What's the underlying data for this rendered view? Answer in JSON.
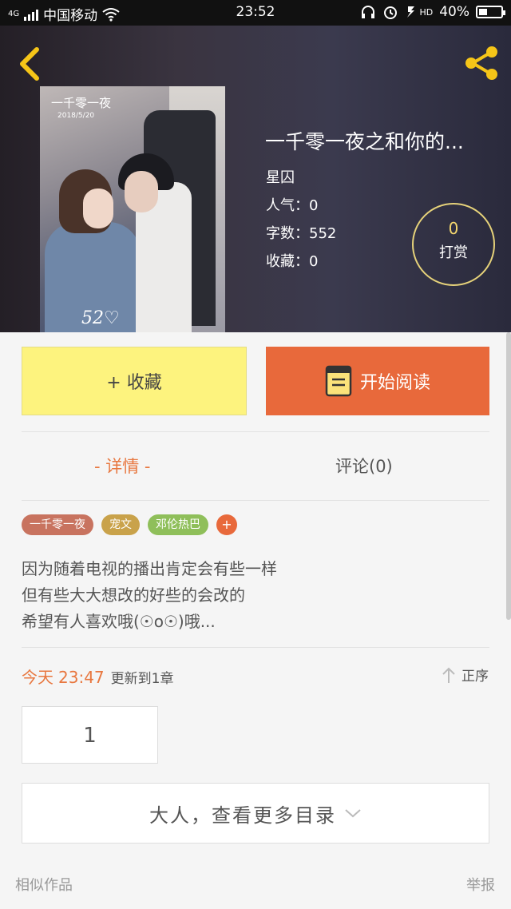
{
  "status_bar": {
    "network": "4G",
    "carrier": "中国移动",
    "time": "23:52",
    "hd": "HD",
    "battery": "40%",
    "battery_level": 0.4
  },
  "book": {
    "title": "一千零一夜之和你的...",
    "author": "星囚",
    "popularity": "人气：0",
    "word_count": "字数：552",
    "favorites": "收藏：0",
    "tip_count": "0",
    "tip_label": "打赏",
    "cover": {
      "title": "一千零一夜",
      "date": "2018/5/20",
      "signature": "52♡"
    }
  },
  "actions": {
    "favorite": "+ 收藏",
    "read": "开始阅读"
  },
  "tabs": [
    {
      "label": "-  详情  -",
      "active": true
    },
    {
      "label": "评论(0)",
      "active": false
    }
  ],
  "tags": [
    {
      "label": "一千零一夜",
      "color": "#c8735f"
    },
    {
      "label": "宠文",
      "color": "#c9a24a"
    },
    {
      "label": "邓伦热巴",
      "color": "#8fbf5a"
    }
  ],
  "tag_add": "+",
  "description": [
    "因为随着电视的播出肯定会有些一样",
    "但有些大大想改的好些的会改的",
    "希望有人喜欢哦(☉o☉)哦..."
  ],
  "update": {
    "day": "今天",
    "time": "23:47",
    "text": "更新到1章",
    "order": "正序"
  },
  "chapters": [
    "1"
  ],
  "more_catalog": "大人，查看更多目录",
  "footer": {
    "similar": "相似作品",
    "report": "举报"
  },
  "colors": {
    "accent": "#e8693b",
    "favorite_bg": "#fdf37e",
    "tab_active": "#e8773f"
  }
}
